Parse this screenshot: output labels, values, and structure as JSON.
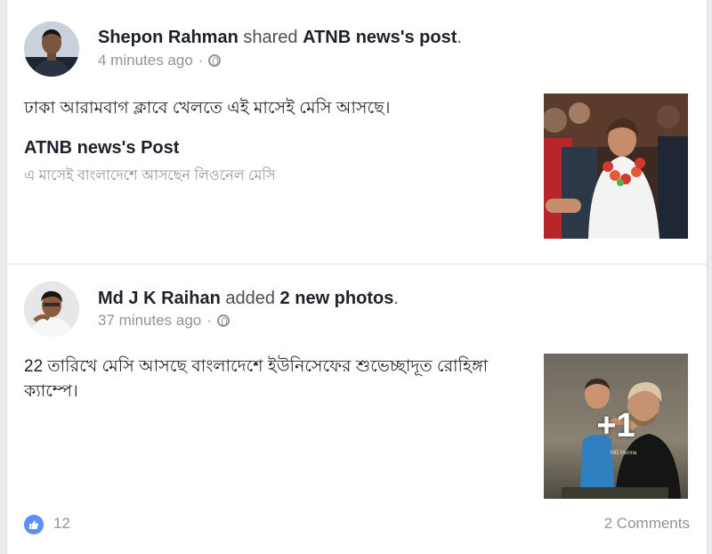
{
  "posts": [
    {
      "actor": "Shepon Rahman",
      "verb": "shared",
      "object": "ATNB news's post",
      "object_suffix": ".",
      "time": "4 minutes ago",
      "text": "ঢাকা আরামবাগ ক্লাবে খেলতে এই মাসেই মেসি আসছে।",
      "shared_title": "ATNB news's Post",
      "shared_subtitle": "এ মাসেই বাংলাদেশে আসছেন লিওনেল মেসি",
      "privacy_icon": "globe-icon"
    },
    {
      "actor": "Md J K Raihan",
      "verb": "added",
      "object": "2 new photos",
      "object_suffix": ".",
      "time": "37 minutes ago",
      "text": "22 তারিখে মেসি আসছে বাংলাদেশে ইউনিসেফের শুভেচ্ছাদূত রোহিঙ্গা ক্যাম্পে।",
      "photo_overlay": "+1",
      "photo_caption": "MD Munna",
      "privacy_icon": "globe-icon"
    }
  ],
  "footer": {
    "like_count": "12",
    "comments": "2 Comments",
    "like_icon": "thumbs-up-icon"
  },
  "colors": {
    "like_blue": "#5890ff",
    "meta_gray": "#90949c",
    "text": "#1d2129"
  }
}
